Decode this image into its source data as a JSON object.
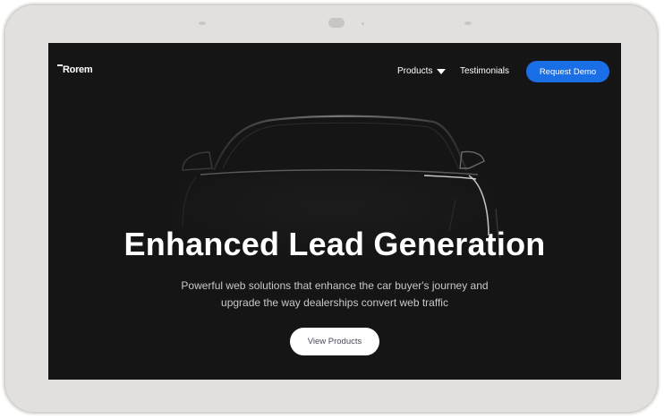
{
  "nav": {
    "logo_text": "Rorem",
    "products_label": "Products",
    "testimonials_label": "Testimonials",
    "demo_label": "Request Demo"
  },
  "hero": {
    "title": "Enhanced Lead Generation",
    "subtitle_line1": "Powerful web solutions that enhance the car buyer's journey and",
    "subtitle_line2": "upgrade the way dealerships convert web traffic",
    "cta_label": "View Products"
  },
  "colors": {
    "screen_bg": "#151515",
    "accent": "#1a6ee6",
    "device_frame": "#e2e0de"
  }
}
